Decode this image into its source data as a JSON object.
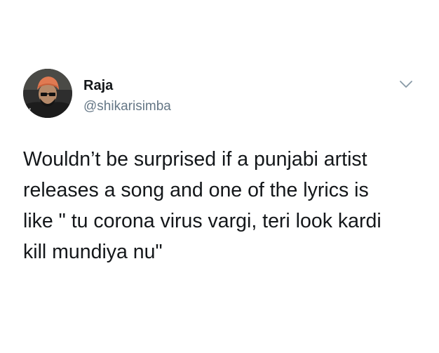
{
  "tweet": {
    "author": {
      "display_name": "Raja",
      "handle": "@shikarisimba",
      "avatar_icon": "profile-photo"
    },
    "menu_icon": "chevron-down-icon",
    "text_lines": [
      "Wouldn’t be surprised if a punjabi artist",
      "releases a song and one of the lyrics is",
      "like \" tu corona virus vargi, teri look kardi",
      "kill mundiya nu\""
    ]
  },
  "colors": {
    "text_primary": "#14171a",
    "text_secondary": "#657786",
    "turban": "#e07a52",
    "background": "#ffffff"
  }
}
